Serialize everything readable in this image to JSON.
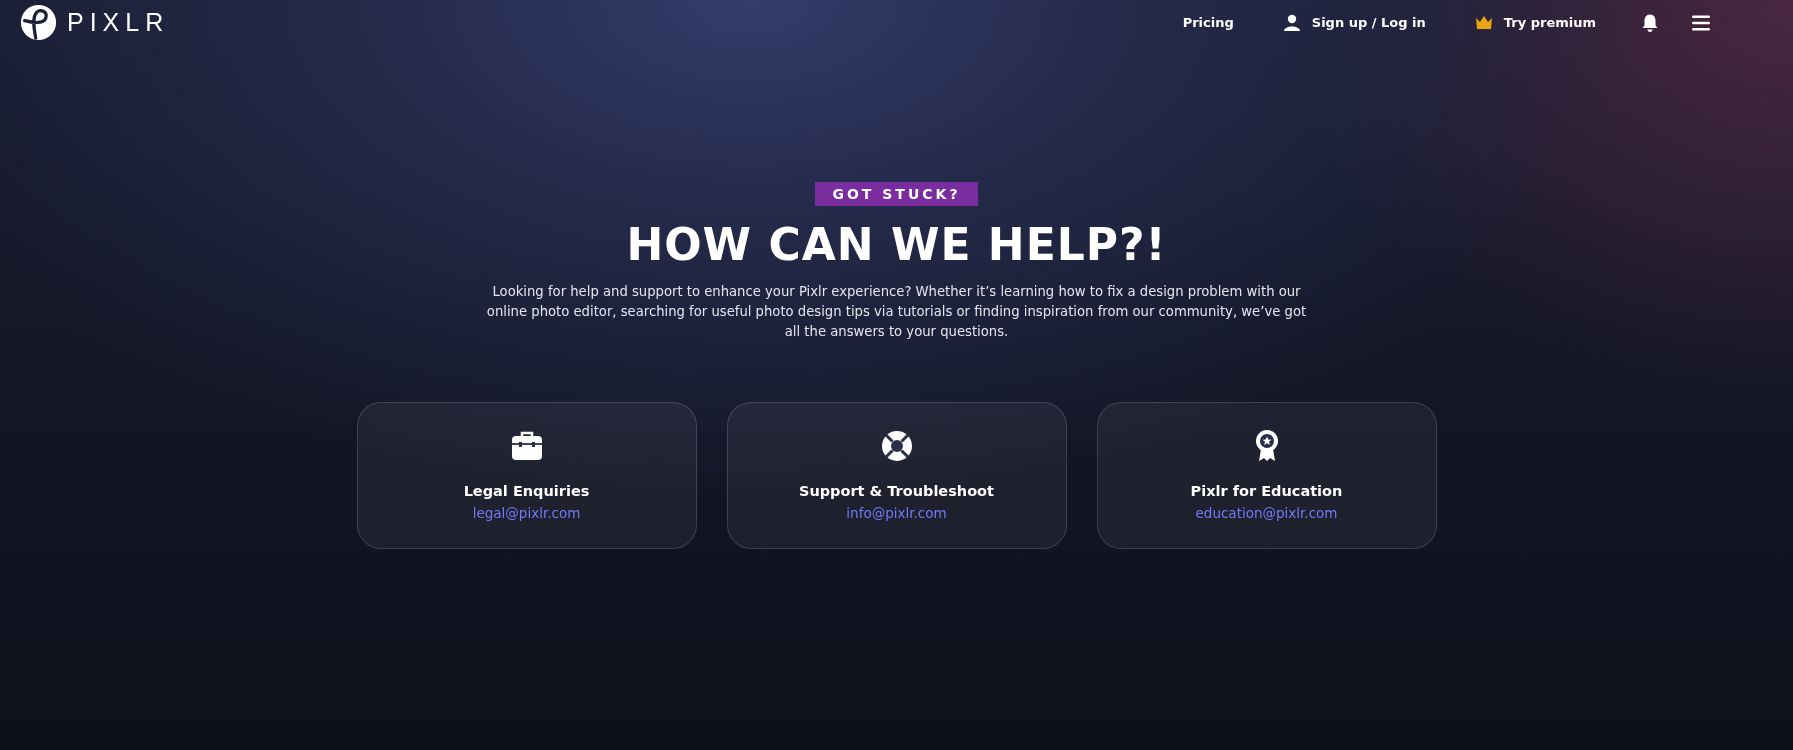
{
  "header": {
    "logo": "PIXLR",
    "nav": [
      {
        "kind": "link",
        "label": "Pricing"
      },
      {
        "kind": "user",
        "label": "Sign up / Log in"
      },
      {
        "kind": "crown",
        "label": "Try premium"
      }
    ]
  },
  "hero": {
    "badge": "GOT STUCK?",
    "title": "HOW CAN WE HELP?!",
    "text": "Looking for help and support to enhance your Pixlr experience? Whether it’s learning how to fix a design problem with our online photo editor, searching for useful photo design tips via tutorials or finding inspiration from our community, we’ve got all the answers to your questions."
  },
  "cards": [
    {
      "kind": "briefcase",
      "title": "Legal Enquiries",
      "email": "legal@pixlr.com"
    },
    {
      "kind": "lifebuoy",
      "title": "Support & Troubleshoot",
      "email": "info@pixlr.com"
    },
    {
      "kind": "award",
      "title": "Pixlr for Education",
      "email": "education@pixlr.com"
    }
  ]
}
